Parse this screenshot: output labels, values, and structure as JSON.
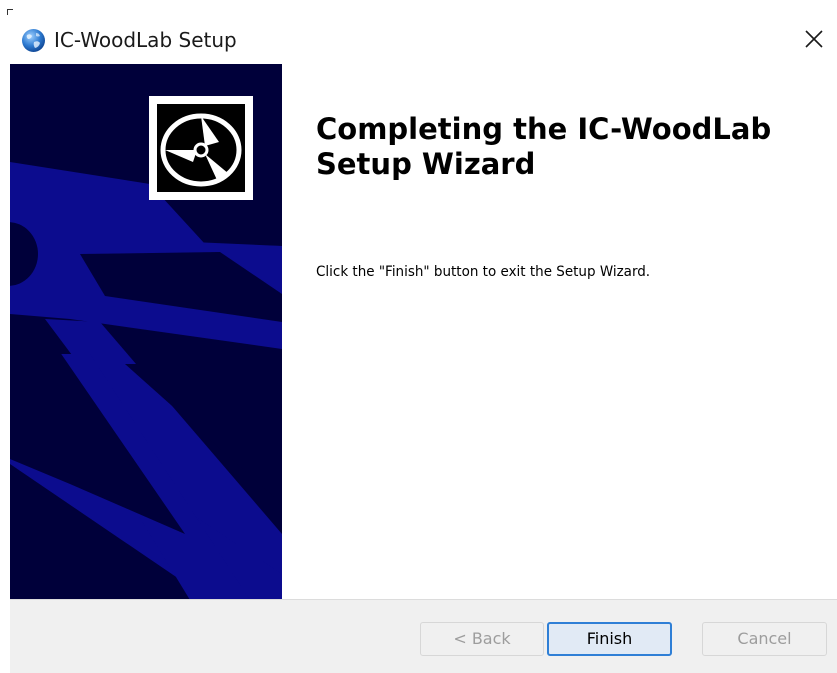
{
  "window": {
    "title": "IC-WoodLab Setup",
    "close_label": "×"
  },
  "content": {
    "heading": "Completing the IC-WoodLab Setup Wizard",
    "description": "Click the \"Finish\" button to exit the Setup Wizard."
  },
  "buttons": {
    "back": "< Back",
    "finish": "Finish",
    "cancel": "Cancel"
  },
  "colors": {
    "banner_background": "#00003a",
    "banner_graphic": "#0c0c8e",
    "footer_background": "#f0f0f0",
    "default_button_border": "#2f7fd6",
    "disabled_text": "#9d9d9d"
  },
  "icons": {
    "app": "globe-icon",
    "close": "close-icon",
    "banner": "cd-disc-icon"
  }
}
